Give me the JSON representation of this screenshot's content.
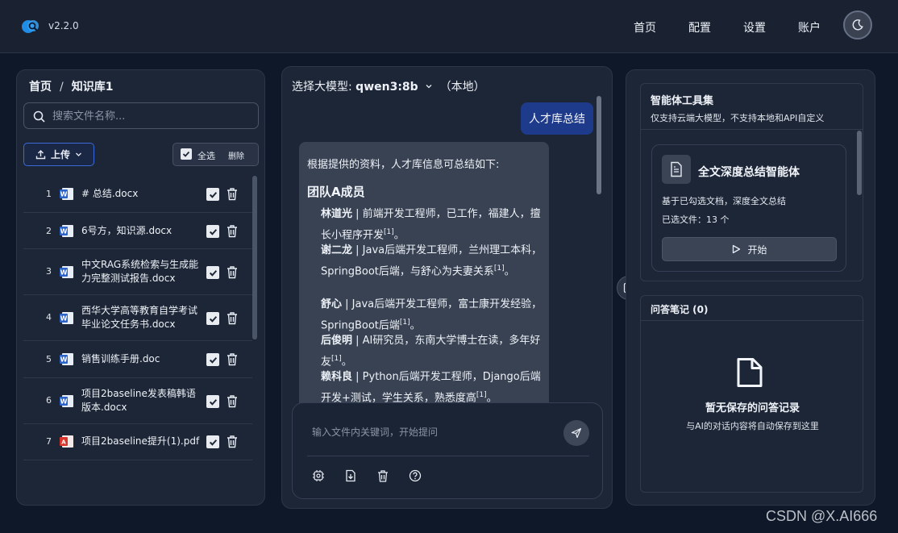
{
  "header": {
    "version": "v2.2.0",
    "nav": [
      "首页",
      "配置",
      "设置",
      "账户"
    ]
  },
  "left": {
    "breadcrumb": [
      "首页",
      "知识库1"
    ],
    "search_placeholder": "搜索文件名称...",
    "upload_label": "上传",
    "select_all_label": "全选",
    "delete_label": "删除",
    "files": [
      {
        "num": "1",
        "name": "# 总结.docx",
        "type": "word"
      },
      {
        "num": "2",
        "name": "6号方，知识源.docx",
        "type": "word"
      },
      {
        "num": "3",
        "name": "中文RAG系统检索与生成能力完整测试报告.docx",
        "type": "word"
      },
      {
        "num": "4",
        "name": "西华大学高等教育自学考试毕业论文任务书.docx",
        "type": "word"
      },
      {
        "num": "5",
        "name": "销售训练手册.doc",
        "type": "word"
      },
      {
        "num": "6",
        "name": "项目2baseline发表稿韩语版本.docx",
        "type": "word"
      },
      {
        "num": "7",
        "name": "项目2baseline提升(1).pdf",
        "type": "pdf"
      }
    ]
  },
  "chat": {
    "model_prefix": "选择大模型:",
    "model_name": "qwen3:8b",
    "model_suffix": "（本地）",
    "user_message": "人才库总结",
    "ai_intro": "根据提供的资料，人才库信息可总结如下:",
    "ai_heading": "团队A成员",
    "people": [
      {
        "name": "林道光",
        "desc": " | 前端开发工程师，已工作，福建人，擅长小程序开发",
        "ref": "[1]",
        "tail": "。"
      },
      {
        "name": "谢二龙",
        "desc": " | Java后端开发工程师，兰州理工本科，SpringBoot后端，与舒心为夫妻关系",
        "ref": "[1]",
        "tail": "。"
      },
      {
        "name": "舒心",
        "desc": " | Java后端开发工程师，富士康开发经验，SpringBoot后端",
        "ref": "[1]",
        "tail": "。"
      },
      {
        "name": "后俊明",
        "desc": " | AI研究员，东南大学博士在读，多年好友",
        "ref": "[1]",
        "tail": "。"
      },
      {
        "name": "赖科良",
        "desc": " | Python后端开发工程师，Django后端开发+测试，学生关系，熟悉度高",
        "ref": "[1]",
        "tail": "。"
      }
    ],
    "input_placeholder": "输入文件内关键词，开始提问"
  },
  "right": {
    "toolset_title": "智能体工具集",
    "toolset_subtitle": "仅支持云端大模型，不支持本地和API自定义",
    "agent_title": "全文深度总结智能体",
    "agent_desc": "基于已勾选文档，深度全文总结",
    "agent_files": "已选文件：13 个",
    "start_label": "开始",
    "notes_title": "问答笔记 (0)",
    "notes_empty": "暂无保存的问答记录",
    "notes_hint": "与AI的对话内容将自动保存到这里"
  },
  "watermark": "CSDN @X.AI666",
  "colors": {
    "accent": "#1e3a8a",
    "background": "#0f1828",
    "panel": "#1d2636"
  }
}
